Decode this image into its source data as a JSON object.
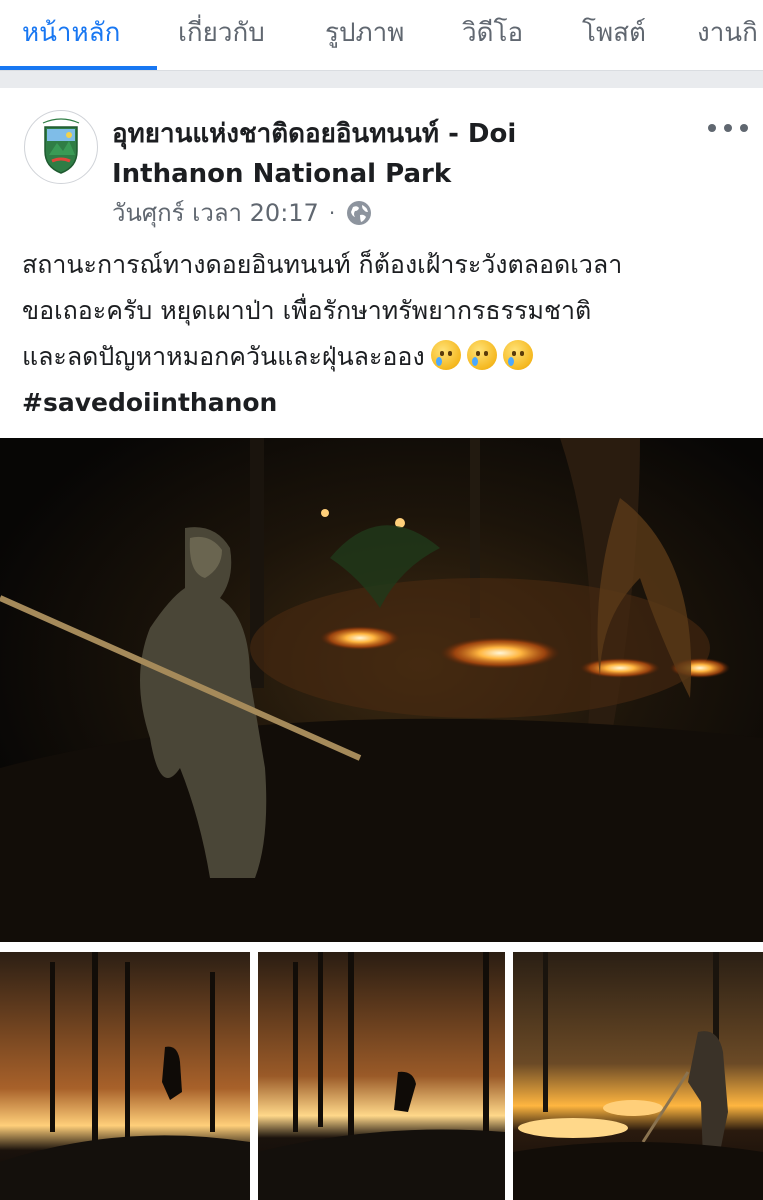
{
  "tabs": [
    {
      "label": "หน้าหลัก",
      "active": true
    },
    {
      "label": "เกี่ยวกับ",
      "active": false
    },
    {
      "label": "รูปภาพ",
      "active": false
    },
    {
      "label": "วิดีโอ",
      "active": false
    },
    {
      "label": "โพสต์",
      "active": false
    },
    {
      "label": "งานกิ",
      "active": false
    }
  ],
  "colors": {
    "accent": "#1877f2",
    "text": "#1c1e21",
    "muted": "#606770",
    "page_bg": "#e9ebee"
  },
  "post": {
    "page_name_line1": "อุทยานแห่งชาติดอยอินทนนท์ - Doi",
    "page_name_line2": "Inthanon National Park",
    "timestamp": "วันศุกร์ เวลา 20:17",
    "separator": "·",
    "privacy_icon": "globe-icon",
    "more_icon": "more-options-icon",
    "text_lines": [
      "สถานะการณ์ทางดอยอินทนนท์ ก็ต้องเฝ้าระวังตลอดเวลา",
      "ขอเถอะครับ หยุดเผาป่า เพื่อรักษาทรัพยากรธรรมชาติ",
      "และลดปัญหาหมอกควันและฝุ่นละออง"
    ],
    "emojis": [
      "crying-face-icon",
      "crying-face-icon",
      "crying-face-icon"
    ],
    "hashtag": "#savedoiinthanon",
    "photos": [
      {
        "name": "main-photo",
        "depicts": "ranger fighting forest fire at night"
      },
      {
        "name": "thumb-photo-1",
        "depicts": "silhouette near burning forest"
      },
      {
        "name": "thumb-photo-2",
        "depicts": "silhouette near burning forest"
      },
      {
        "name": "thumb-photo-3",
        "depicts": "ranger beating flames on slope"
      }
    ]
  }
}
